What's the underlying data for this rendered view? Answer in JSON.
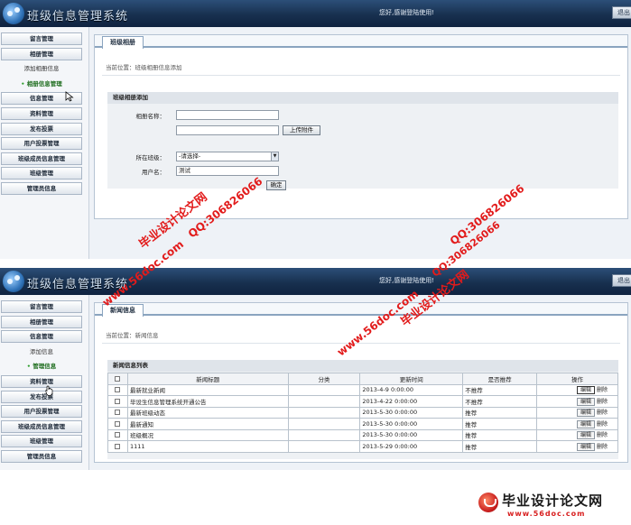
{
  "app_title": "班级信息管理系统",
  "welcome_text": "您好,感谢登陆使用!",
  "logout_label": "退出",
  "screen1": {
    "sidebar": [
      {
        "label": "留言管理",
        "kind": "button"
      },
      {
        "label": "相册管理",
        "kind": "button"
      },
      {
        "label": "添加相册信息",
        "kind": "sub"
      },
      {
        "label": "相册信息管理",
        "kind": "sub-active"
      },
      {
        "label": "信息管理",
        "kind": "button"
      },
      {
        "label": "资料管理",
        "kind": "button"
      },
      {
        "label": "发布投票",
        "kind": "button"
      },
      {
        "label": "用户投票管理",
        "kind": "button"
      },
      {
        "label": "班级成员信息管理",
        "kind": "button"
      },
      {
        "label": "班级管理",
        "kind": "button"
      },
      {
        "label": "管理员信息",
        "kind": "button"
      }
    ],
    "tab_label": "班级相册",
    "breadcrumb": "当前位置：班级相册信息添加",
    "form_title": "班级相册添加",
    "fields": {
      "album_name_label": "相册名称：",
      "album_name_value": "",
      "attachment_value": "",
      "upload_label": "上传附件",
      "class_label": "所在班级：",
      "class_selected": "-请选择-",
      "username_label": "用户名：",
      "username_value": "测试",
      "submit_label": "确定"
    }
  },
  "screen2": {
    "sidebar": [
      {
        "label": "留言管理",
        "kind": "button"
      },
      {
        "label": "相册管理",
        "kind": "button"
      },
      {
        "label": "信息管理",
        "kind": "button"
      },
      {
        "label": "添加信息",
        "kind": "sub"
      },
      {
        "label": "管理信息",
        "kind": "sub-active"
      },
      {
        "label": "资料管理",
        "kind": "button"
      },
      {
        "label": "发布投票",
        "kind": "button"
      },
      {
        "label": "用户投票管理",
        "kind": "button"
      },
      {
        "label": "班级成员信息管理",
        "kind": "button"
      },
      {
        "label": "班级管理",
        "kind": "button"
      },
      {
        "label": "管理员信息",
        "kind": "button"
      }
    ],
    "tab_label": "新闻信息",
    "breadcrumb": "当前位置：新闻信息",
    "list_title": "新闻信息列表",
    "columns": [
      "",
      "新闻标题",
      "分类",
      "更新时间",
      "是否推荐",
      "操作"
    ],
    "rows": [
      {
        "title": "最新就业新闻",
        "category": "",
        "updated": "2013-4-9 0:00:00",
        "recommended": "不推荐"
      },
      {
        "title": "毕设生信息管理系统开通公告",
        "category": "",
        "updated": "2013-4-22 0:00:00",
        "recommended": "不推荐"
      },
      {
        "title": "最新班级动态",
        "category": "",
        "updated": "2013-5-30 0:00:00",
        "recommended": "推荐"
      },
      {
        "title": "最新通知",
        "category": "",
        "updated": "2013-5-30 0:00:00",
        "recommended": "推荐"
      },
      {
        "title": "班级概况",
        "category": "",
        "updated": "2013-5-30 0:00:00",
        "recommended": "推荐"
      },
      {
        "title": "1111",
        "category": "",
        "updated": "2013-5-29 0:00:00",
        "recommended": "推荐"
      }
    ],
    "edit_label": "编辑",
    "delete_label": "删除"
  },
  "watermarks": {
    "site_url": "www.56doc.com",
    "qq": "QQ:306826066",
    "brand": "毕业设计论文网"
  },
  "footer_logo": {
    "title": "毕业设计论文网",
    "url": "www.56doc.com",
    "icon": "doc-logo-icon"
  },
  "colors": {
    "header": "#18304f",
    "watermark": "#e21b1b",
    "active_nav": "#1e6d1e"
  }
}
